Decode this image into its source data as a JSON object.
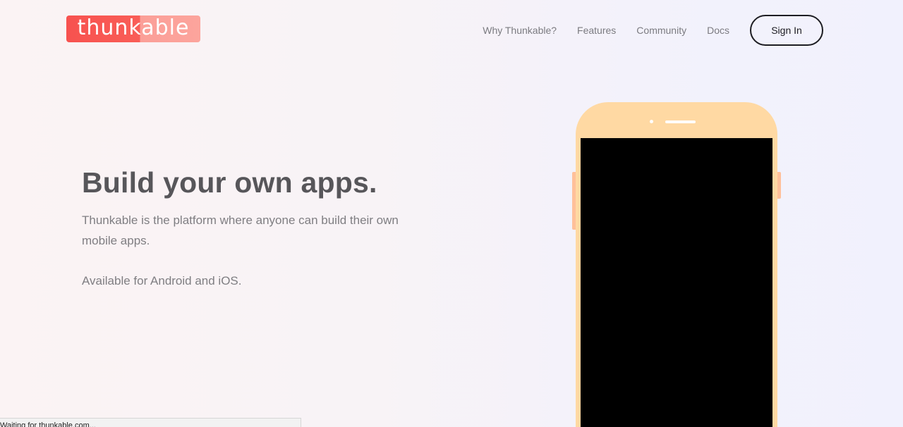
{
  "brand": {
    "logo_text": "thunkable",
    "colors": {
      "logo_left": "#f7524f",
      "logo_right": "#fca49c",
      "phone_body": "#ffd9a3",
      "phone_buttons": "#ffc09a",
      "text_dark": "#57565a"
    }
  },
  "nav": {
    "items": [
      {
        "label": "Why Thunkable?"
      },
      {
        "label": "Features"
      },
      {
        "label": "Community"
      },
      {
        "label": "Docs"
      }
    ],
    "signin_label": "Sign In"
  },
  "hero": {
    "title": "Build your own apps.",
    "subtitle": "Thunkable is the platform where anyone can build their own mobile apps.",
    "availability": "Available for Android and iOS."
  },
  "status_bar": {
    "text": "Waiting for thunkable.com..."
  }
}
